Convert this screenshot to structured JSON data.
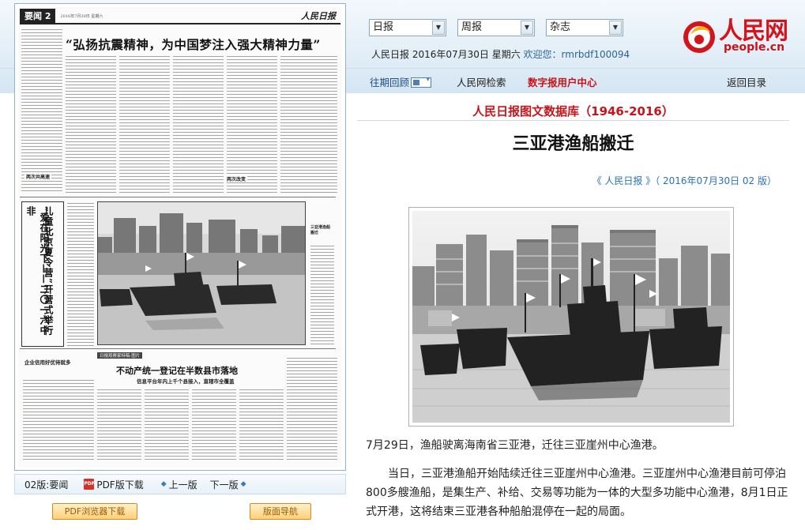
{
  "toolbar": {
    "select_daily": "日报",
    "select_weekly": "周报",
    "select_magazine": "杂志"
  },
  "user_line": {
    "date_info": "人民日报 2016年07月30日 星期六",
    "welcome": "欢迎您：rmrbdf100094"
  },
  "logo": {
    "cn": "人民网",
    "en": "people.cn"
  },
  "nav": {
    "past_review": "往期回顾",
    "search": "人民网检索",
    "user_center": "数字报用户中心",
    "back": "返回目录"
  },
  "newspaper_page": {
    "section": "要闻 2",
    "date": "2016年7月30日 星期六",
    "masthead": "人民日报",
    "headline": "“弘扬抗震精神，为中国梦注入强大精神力量”",
    "vertical_headline_1": "“爱在阳光下——二〇一六中非",
    "vertical_headline_2": "儿童北京夏令营”开营式举行",
    "photo_caption": "三亚港渔船搬迁",
    "lower_tag": "日报观察家特稿·图片",
    "lower_headline": "不动产统一登记在半数县市落地",
    "lower_subhead": "信息平台年内上千个县接入，直辖市全覆盖",
    "left_lower_head": "企业信用好优待就多",
    "small_head_1": "两次共高速",
    "small_head_2": "两次改变"
  },
  "page_nav": {
    "current_page": "02版:要闻",
    "pdf": "PDF版下载",
    "prev": "上一版",
    "next": "下一版"
  },
  "buttons": {
    "pdf_reader": "PDF浏览器下载",
    "page_nav": "版面导航"
  },
  "article": {
    "database_title": "人民日报图文数据库（1946-2016）",
    "title": "三亚港渔船搬迁",
    "source": "《 人民日报 》（ 2016年07月30日   02 版）",
    "paragraphs": [
      "7月29日，渔船驶离海南省三亚港，迁往三亚崖州中心渔港。",
      "当日，三亚港渔船开始陆续迁往三亚崖州中心渔港。三亚崖州中心渔港目前可停泊800多艘渔船，是集生产、补给、交易等功能为一体的大型多功能中心渔港，8月1日正式开港，这将结束三亚港各种船舶混停在一起的局面。"
    ]
  },
  "icons": [
    "chevron-down-icon",
    "calendar-icon",
    "pdf-icon",
    "arrow-left-icon",
    "arrow-right-icon",
    "people-logo"
  ],
  "colors": {
    "brand_red": "#c8131a",
    "link_blue": "#2a72b8",
    "band_blue": "#e2eef7"
  }
}
